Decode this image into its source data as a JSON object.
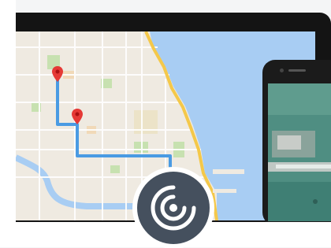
{
  "colors": {
    "background": "#f4f5f6",
    "tablet_frame": "#141414",
    "map_land": "#efeae1",
    "map_water": "#a8cdf3",
    "map_park": "#c7e1b0",
    "map_highway": "#f4c84a",
    "route": "#4a9be3",
    "pin": "#e53935",
    "logo_badge": "#45505e",
    "phone_water": "#4f8e82"
  },
  "icons": {
    "map_pin_start": "map-pin-icon",
    "map_pin_end": "map-pin-icon",
    "logo": "radar-signal-icon"
  }
}
